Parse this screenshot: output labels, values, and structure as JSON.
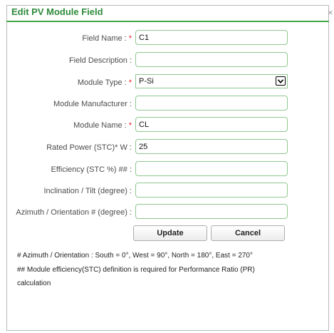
{
  "dialog": {
    "title": "Edit PV Module Field",
    "close_glyph": "×"
  },
  "form": {
    "field_name": {
      "label": "Field Name :",
      "required_mark": "*",
      "value": "C1"
    },
    "field_description": {
      "label": "Field Description :",
      "value": ""
    },
    "module_type": {
      "label": "Module Type :",
      "required_mark": "*",
      "selected": "P-Si"
    },
    "module_manufacturer": {
      "label": "Module Manufacturer :",
      "value": ""
    },
    "module_name": {
      "label": "Module Name :",
      "required_mark": "*",
      "value": "CL"
    },
    "rated_power": {
      "label": "Rated Power (STC)* W :",
      "value": "25"
    },
    "efficiency": {
      "label": "Efficiency (STC %) ## :",
      "value": ""
    },
    "inclination": {
      "label": "Inclination / Tilt (degree) :",
      "value": ""
    },
    "azimuth": {
      "label": "Azimuth / Orientation # (degree) :",
      "value": ""
    }
  },
  "buttons": {
    "update_label": "Update",
    "cancel_label": "Cancel"
  },
  "notes": {
    "azimuth_note": "# Azimuth / Orientation : South = 0°, West = 90°, North = 180°, East = 270°",
    "efficiency_note_line1": "## Module efficiency(STC) definition is required for Performance Ratio (PR)",
    "efficiency_note_line2": "calculation"
  },
  "colors": {
    "title_green": "#2e8a3a",
    "rule_green": "#3fa447",
    "field_border": "#8fc88f",
    "required_red": "#e02020"
  }
}
